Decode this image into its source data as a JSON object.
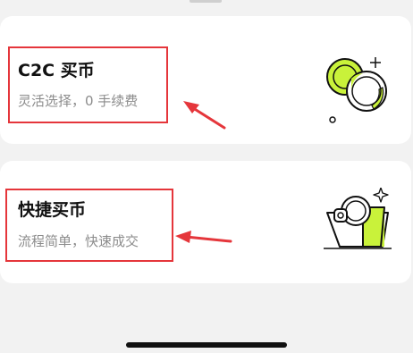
{
  "options": [
    {
      "title": "C2C 买币",
      "subtitle": "灵活选择，0 手续费",
      "icon": "coins-icon"
    },
    {
      "title": "快捷买币",
      "subtitle": "流程简单，快速成交",
      "icon": "wallet-coin-icon"
    }
  ],
  "colors": {
    "background": "#f2f2f2",
    "card": "#ffffff",
    "highlight": "#e5363b",
    "accent_green": "#c9f23a",
    "title": "#111111",
    "subtitle": "#8c8c8c"
  }
}
